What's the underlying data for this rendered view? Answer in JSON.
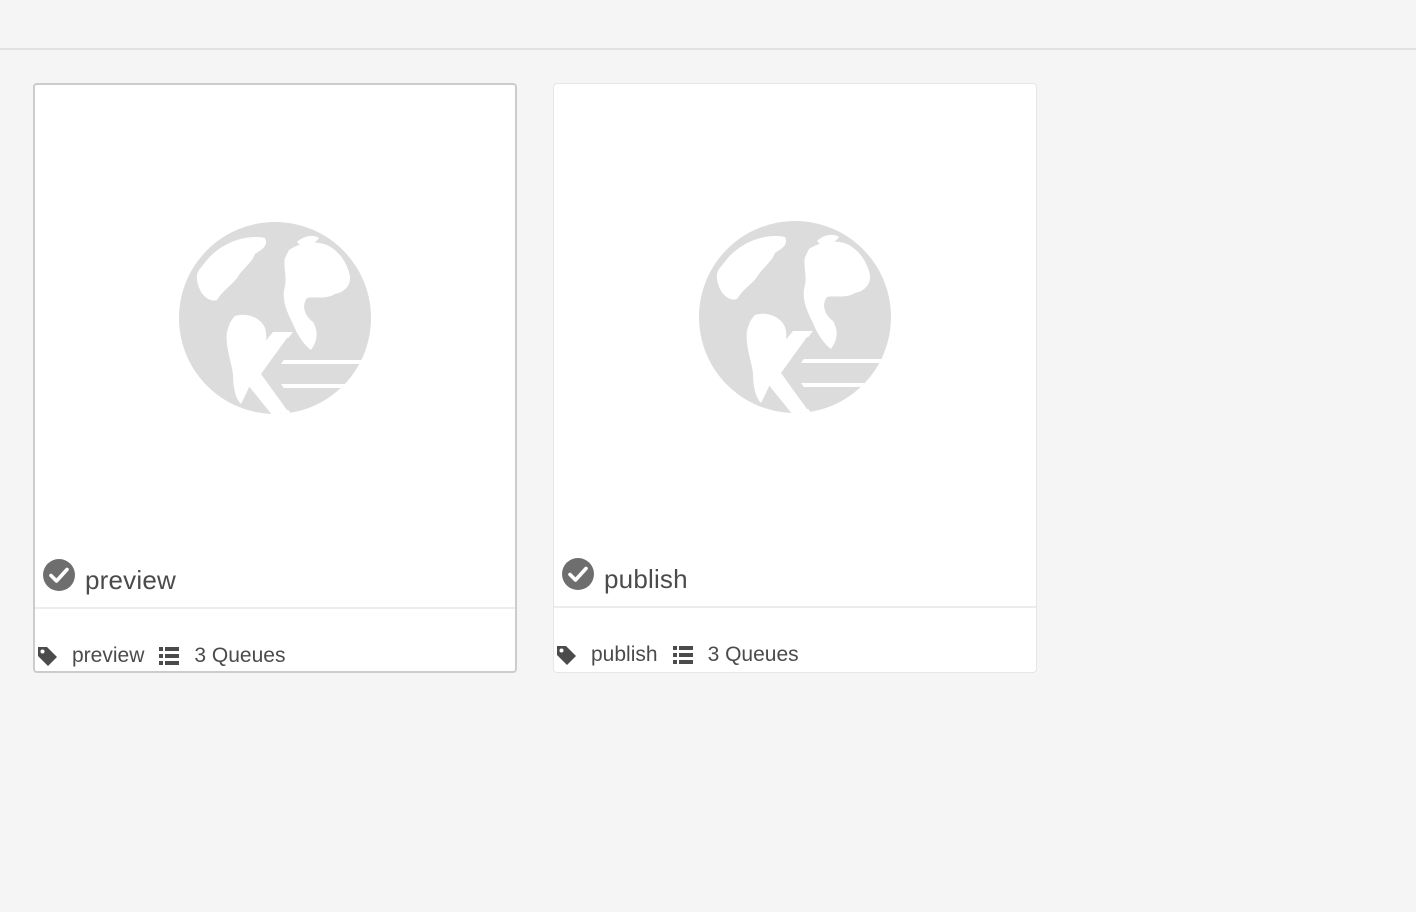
{
  "cards": [
    {
      "title": "preview",
      "tag": "preview",
      "queues": "3 Queues",
      "status_icon": "checkmark-circle-icon",
      "thumbnail_icon": "globe-arrow-icon",
      "selected": true
    },
    {
      "title": "publish",
      "tag": "publish",
      "queues": "3 Queues",
      "status_icon": "checkmark-circle-icon",
      "thumbnail_icon": "globe-arrow-icon",
      "selected": false
    }
  ],
  "colors": {
    "background": "#f5f5f5",
    "card": "#ffffff",
    "icon_gray": "#dcdcdc",
    "status_gray": "#6e6e6e",
    "text": "#4b4b4b"
  }
}
